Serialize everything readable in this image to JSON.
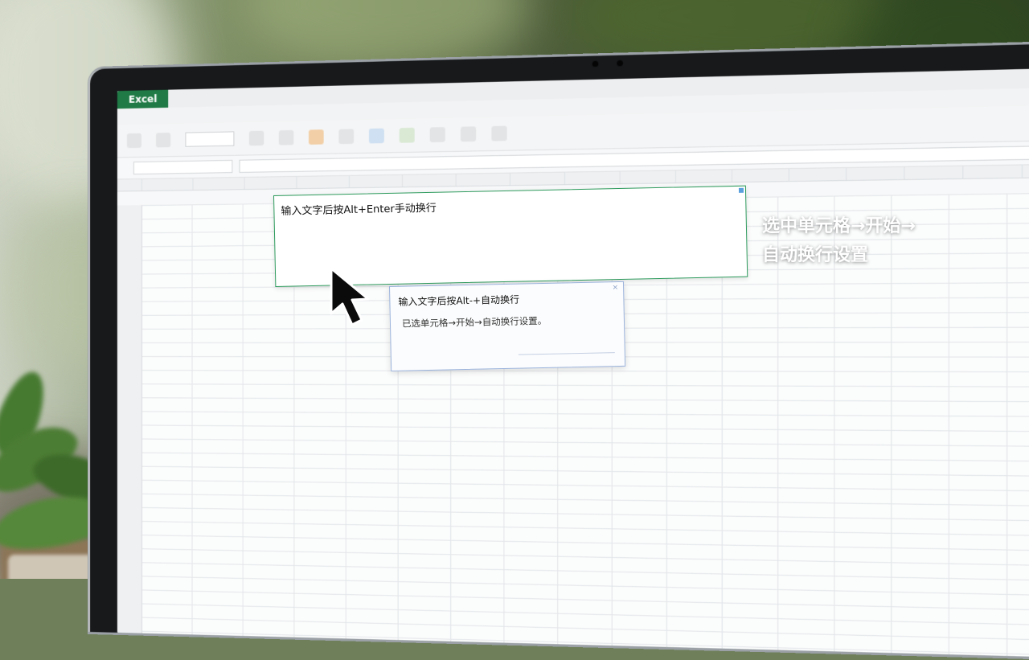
{
  "app": {
    "logo": "Excel"
  },
  "hint_primary": {
    "title": "输入文字后按Alt+Enter手动换行"
  },
  "hint_secondary": {
    "title": "输入文字后按Alt-+自动换行",
    "body": "已选单元格→开始→自动换行设置。",
    "close_icon": "close-icon"
  },
  "caption": {
    "line1": "选中单元格→开始→",
    "line2": "自动换行设置"
  },
  "colors": {
    "excel_green": "#1f7a45",
    "card_border": "#2e9b5d",
    "card2_border": "#9bb3dc",
    "caption_text": "#ffffff"
  },
  "icons": {
    "cursor": "mouse-pointer-icon"
  }
}
